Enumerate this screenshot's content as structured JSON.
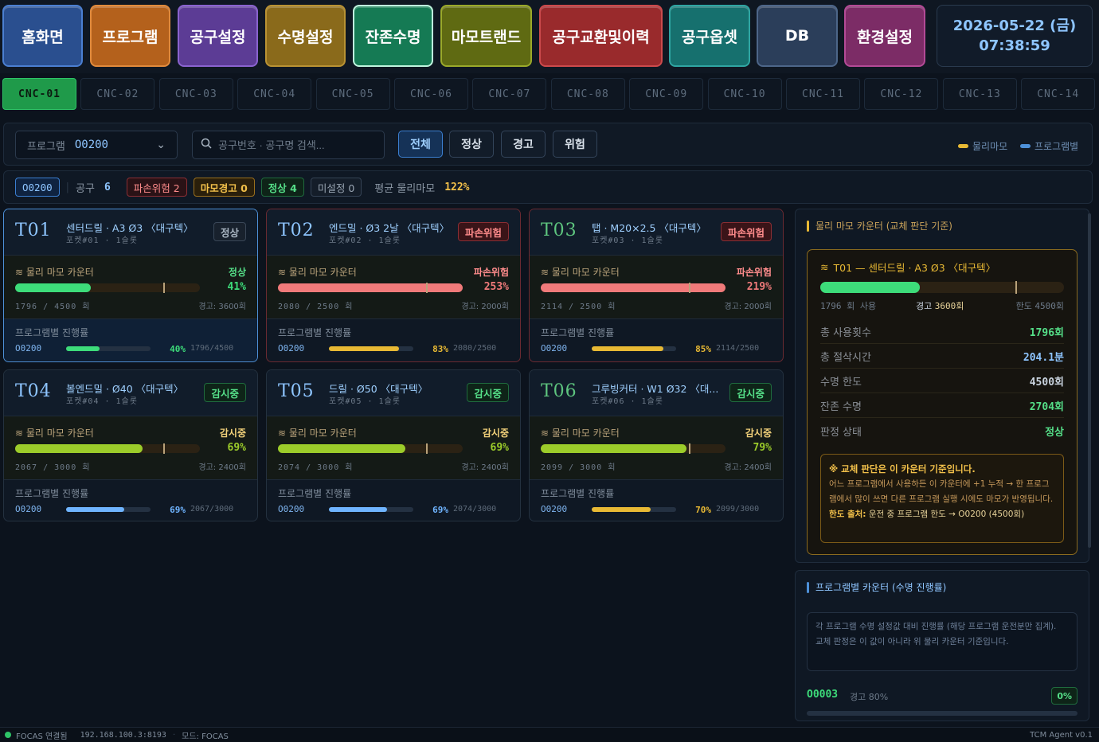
{
  "nav": [
    {
      "label": "홈화면",
      "bg": "#2a4f8f",
      "border": "#4b7fd1"
    },
    {
      "label": "프로그램",
      "bg": "#b4611c",
      "border": "#e08a3c"
    },
    {
      "label": "공구설정",
      "bg": "#5c3c95",
      "border": "#8a63cf"
    },
    {
      "label": "수명설정",
      "bg": "#8a6a1b",
      "border": "#b99233"
    },
    {
      "label": "잔존수명",
      "bg": "#157a54",
      "border": "#bff5de"
    },
    {
      "label": "마모트랜드",
      "bg": "#5f6a12",
      "border": "#9aa92a"
    },
    {
      "label": "공구교환및이력",
      "bg": "#992a2c",
      "border": "#cc4a4c"
    },
    {
      "label": "공구옵셋",
      "bg": "#16706e",
      "border": "#2fa5a2"
    },
    {
      "label": "DB",
      "bg": "#2b3e5a",
      "border": "#4d6689"
    },
    {
      "label": "환경설정",
      "bg": "#7c2c66",
      "border": "#b34a96"
    }
  ],
  "clock": {
    "date": "2026-05-22 (금)",
    "time": "07:38:59"
  },
  "machines": [
    "CNC-01",
    "CNC-02",
    "CNC-03",
    "CNC-04",
    "CNC-05",
    "CNC-06",
    "CNC-07",
    "CNC-08",
    "CNC-09",
    "CNC-10",
    "CNC-11",
    "CNC-12",
    "CNC-13",
    "CNC-14"
  ],
  "filter": {
    "program_label": "프로그램",
    "program_value": "O0200",
    "search_placeholder": "공구번호 · 공구명 검색...",
    "buttons": [
      "전체",
      "정상",
      "경고",
      "위험"
    ],
    "legend_physical": "물리마모",
    "legend_program": "프로그램별",
    "legend_physical_color": "#e8b934",
    "legend_program_color": "#4d90d8"
  },
  "summary": {
    "program": "O0200",
    "tools_label": "공구",
    "tools_count": "6",
    "danger": "파손위험 2",
    "warn": "마모경고 0",
    "normal": "정상 4",
    "unset": "미설정 0",
    "avg_label": "평균 물리마모",
    "avg_value": "122%"
  },
  "wear_label": "물리 마모 카운터",
  "prog_label": "프로그램별 진행률",
  "tools": [
    {
      "id": "T01",
      "name": "센터드릴 · A3 Ø3 〈대구텍〉",
      "pocket": "포켓#01 · 1슬롯",
      "badge": "정상",
      "status": "정상",
      "pct": 41,
      "pct_text": "41%",
      "count": "1796 / 4500 회",
      "warn": "경고: 3600회",
      "warn_ratio": 0.8,
      "prog": "O0200",
      "prog_pct": 40,
      "prog_pct_text": "40%",
      "prog_count": "1796/4500",
      "color": "#3ddc7a",
      "prog_color": "#3ddc7a",
      "kind": "ok"
    },
    {
      "id": "T02",
      "name": "엔드밀 · Ø3 2날 〈대구텍〉",
      "pocket": "포켓#02 · 1슬롯",
      "badge": "파손위험",
      "status": "파손위험",
      "pct": 253,
      "pct_text": "253%",
      "count": "2080 / 2500 회",
      "warn": "경고: 2000회",
      "warn_ratio": 0.8,
      "prog": "O0200",
      "prog_pct": 83,
      "prog_pct_text": "83%",
      "prog_count": "2080/2500",
      "color": "#f07a7a",
      "prog_color": "#e8b934",
      "kind": "danger"
    },
    {
      "id": "T03",
      "name": "탭 · M20×2.5 〈대구텍〉",
      "pocket": "포켓#03 · 1슬롯",
      "badge": "파손위험",
      "status": "파손위험",
      "pct": 219,
      "pct_text": "219%",
      "count": "2114 / 2500 회",
      "warn": "경고: 2000회",
      "warn_ratio": 0.8,
      "prog": "O0200",
      "prog_pct": 85,
      "prog_pct_text": "85%",
      "prog_count": "2114/2500",
      "color": "#f07a7a",
      "prog_color": "#e8b934",
      "kind": "danger"
    },
    {
      "id": "T04",
      "name": "볼엔드밀 · Ø40 〈대구텍〉",
      "pocket": "포켓#04 · 1슬롯",
      "badge": "감시중",
      "status": "감시중",
      "pct": 69,
      "pct_text": "69%",
      "count": "2067 / 3000 회",
      "warn": "경고: 2400회",
      "warn_ratio": 0.8,
      "prog": "O0200",
      "prog_pct": 69,
      "prog_pct_text": "69%",
      "prog_count": "2067/3000",
      "color": "#9ccc2a",
      "prog_color": "#6fb4ff",
      "kind": "watch"
    },
    {
      "id": "T05",
      "name": "드릴 · Ø50 〈대구텍〉",
      "pocket": "포켓#05 · 1슬롯",
      "badge": "감시중",
      "status": "감시중",
      "pct": 69,
      "pct_text": "69%",
      "count": "2074 / 3000 회",
      "warn": "경고: 2400회",
      "warn_ratio": 0.8,
      "prog": "O0200",
      "prog_pct": 69,
      "prog_pct_text": "69%",
      "prog_count": "2074/3000",
      "color": "#9ccc2a",
      "prog_color": "#6fb4ff",
      "kind": "watch"
    },
    {
      "id": "T06",
      "name": "그루빙커터 · W1 Ø32 〈대...",
      "pocket": "포켓#06 · 1슬롯",
      "badge": "감시중",
      "status": "감시중",
      "pct": 79,
      "pct_text": "79%",
      "count": "2099 / 3000 회",
      "warn": "경고: 2400회",
      "warn_ratio": 0.8,
      "prog": "O0200",
      "prog_pct": 70,
      "prog_pct_text": "70%",
      "prog_count": "2099/3000",
      "color": "#9ccc2a",
      "prog_color": "#e8b934",
      "kind": "watch"
    }
  ],
  "detail": {
    "title": "물리 마모 카운터 (교체 판단 기준)",
    "tool": "T01 — 센터드릴 · A3 Ø3 〈대구텍〉",
    "pct": 41,
    "warn_ratio": 0.8,
    "used": "1796 회 사용",
    "warn_label": "경고",
    "warn_value": "3600회",
    "limit_label": "한도",
    "limit_value": "4500회",
    "rows": [
      {
        "k": "총 사용횟수",
        "v": "1796회"
      },
      {
        "k": "총 절삭시간",
        "v": "204.1분"
      },
      {
        "k": "수명 한도",
        "v": "4500회"
      },
      {
        "k": "잔존 수명",
        "v": "2704회"
      },
      {
        "k": "판정 상태",
        "v": "정상"
      }
    ],
    "note_title": "※ 교체 판단은 이 카운터 기준입니다.",
    "note_body": "어느 프로그램에서 사용하든 이 카운터에 +1 누적 → 한 프로그램에서 많이 쓰면 다른 프로그램 실행 시에도 마모가 반영됩니다.",
    "note_limit_label": "한도 출처:",
    "note_limit_value": " 운전 중 프로그램 한도 → O0200 (4500회)"
  },
  "program_panel": {
    "title": "프로그램별 카운터 (수명 진행률)",
    "desc1": "각 프로그램 수명 설정값 대비 진행률 (해당 프로그램 운전분만 집계).",
    "desc2": "교체 판정은 이 값이 아니라 위 물리 카운터 기준입니다.",
    "row_prog": "O0003",
    "row_warn": "경고 80%",
    "row_pct": "0%"
  },
  "status": {
    "conn": "FOCAS 연결됨",
    "ip": "192.168.100.3:8193",
    "mode": "모드: FOCAS",
    "version": "TCM Agent v0.1"
  }
}
